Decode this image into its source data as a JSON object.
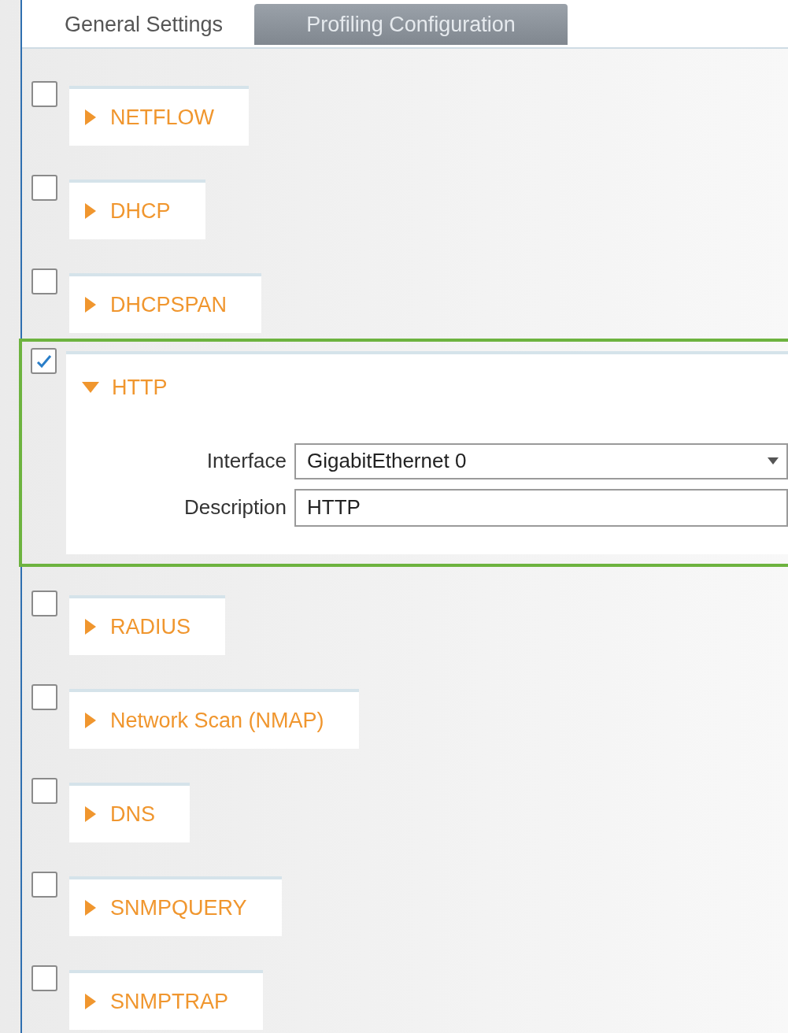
{
  "tabs": [
    {
      "label": "General Settings",
      "selected": false
    },
    {
      "label": "Profiling Configuration",
      "selected": true
    }
  ],
  "sections": [
    {
      "label": "NETFLOW",
      "checked": false,
      "expanded": false
    },
    {
      "label": "DHCP",
      "checked": false,
      "expanded": false
    },
    {
      "label": "DHCPSPAN",
      "checked": false,
      "expanded": false
    },
    {
      "label": "HTTP",
      "checked": true,
      "expanded": true,
      "fields": [
        {
          "kind": "select",
          "label": "Interface",
          "value": "GigabitEthernet 0"
        },
        {
          "kind": "text",
          "label": "Description",
          "value": "HTTP"
        }
      ]
    },
    {
      "label": "RADIUS",
      "checked": false,
      "expanded": false
    },
    {
      "label": "Network Scan (NMAP)",
      "checked": false,
      "expanded": false
    },
    {
      "label": "DNS",
      "checked": false,
      "expanded": false
    },
    {
      "label": "SNMPQUERY",
      "checked": false,
      "expanded": false
    },
    {
      "label": "SNMPTRAP",
      "checked": false,
      "expanded": false
    }
  ]
}
